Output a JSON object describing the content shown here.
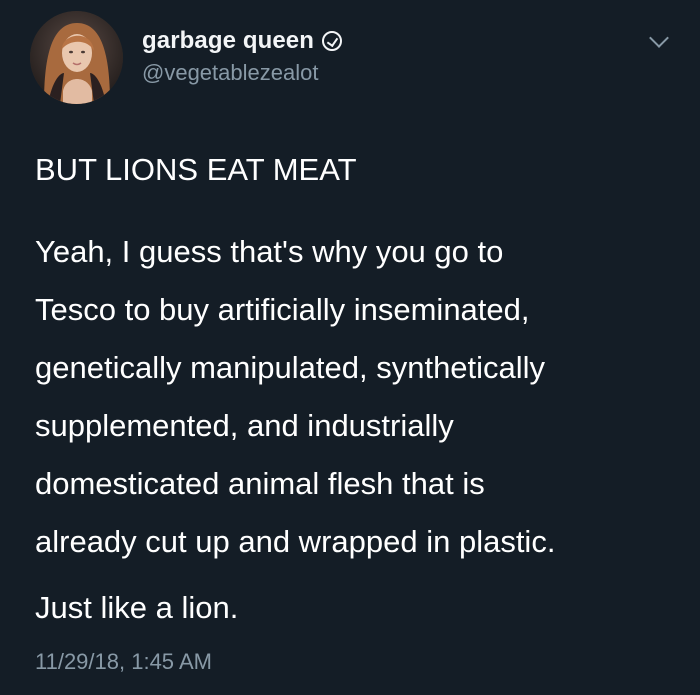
{
  "user": {
    "display_name": "garbage queen",
    "handle": "@vegetablezealot"
  },
  "tweet": {
    "headline": "BUT LIONS EAT MEAT",
    "paragraph_lines": [
      "Yeah, I guess that's why you go to",
      "Tesco to buy artificially inseminated,",
      "genetically manipulated, synthetically",
      "supplemented, and industrially",
      "domesticated animal flesh that is",
      "already cut up and wrapped in plastic."
    ],
    "closing": "Just like a lion.",
    "timestamp": "11/29/18, 1:45 AM"
  },
  "icons": {
    "verified": "verified-icon",
    "menu": "chevron-down-icon"
  },
  "colors": {
    "background": "#141d26",
    "primary_text": "#ffffff",
    "secondary_text": "#8899a6"
  }
}
